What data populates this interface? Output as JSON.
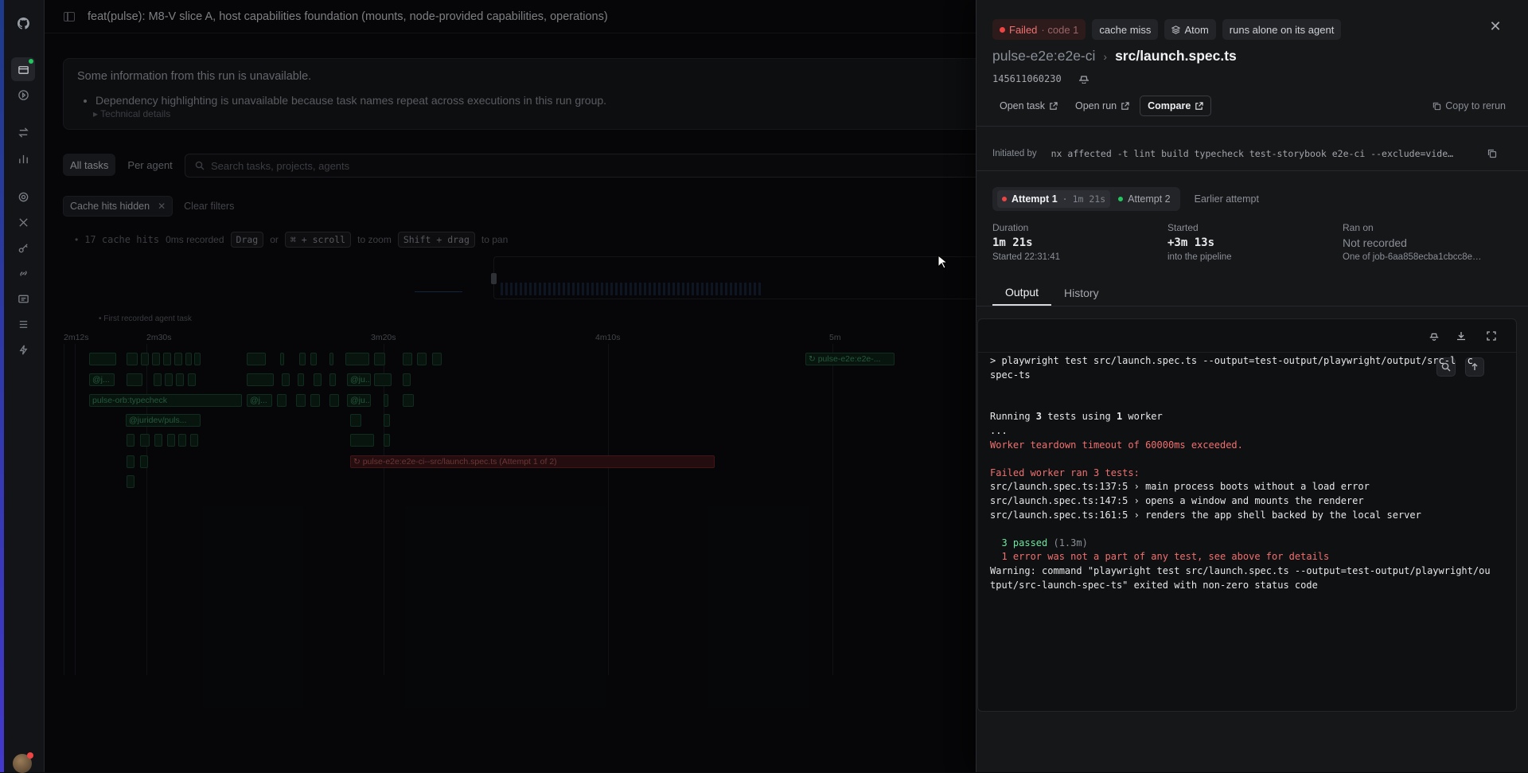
{
  "rail": {
    "icons": [
      "github-icon",
      "box-icon",
      "play-circle-icon",
      "swap-icon",
      "bar-chart-icon",
      "settings-icon",
      "tools-icon",
      "key-icon",
      "link-icon",
      "card-icon",
      "sliders-icon",
      "bolt-icon"
    ]
  },
  "topbar": {
    "title": "feat(pulse): M8-V slice A, host capabilities foundation (mounts, node-provided capabilities, operations)"
  },
  "notice": {
    "heading": "Some information from this run is unavailable.",
    "item": "Dependency highlighting is unavailable because task names repeat across executions in this run group.",
    "details": "▸ Technical details"
  },
  "view_toggle": {
    "all": "All tasks",
    "per_agent": "Per agent"
  },
  "search": {
    "placeholder": "Search tasks, projects, agents"
  },
  "filters": {
    "chip": "Cache hits hidden",
    "clear": "Clear filters"
  },
  "hints": {
    "cache": "17 cache hits",
    "recorded": "0ms recorded",
    "drag": "Drag",
    "or": "or",
    "scroll": "⌘ + scroll",
    "to_zoom": "to zoom",
    "shift_drag": "Shift + drag",
    "to_pan": "to pan"
  },
  "timeline": {
    "first_recorded": "• First recorded agent task",
    "ticks": [
      "2m12s",
      "2m30s",
      "3m20s",
      "4m10s",
      "5m"
    ],
    "labels": {
      "e2e_short": "↻ pulse-e2e:e2e-...",
      "ju1": "@j...",
      "ju2": "@ju...",
      "orb": "pulse-orb:typecheck",
      "j3": "@j...",
      "ju4": "@ju...",
      "juridev": "@juridev/puls...",
      "failed": "↻ pulse-e2e:e2e-ci--src/launch.spec.ts (Attempt 1 of 2)"
    }
  },
  "panel": {
    "badges": {
      "failed": "Failed",
      "code": "· code 1",
      "cache": "cache miss",
      "atom": "Atom",
      "alone": "runs alone on its agent"
    },
    "project": "pulse-e2e:e2e-ci",
    "file": "src/launch.spec.ts",
    "run_id": "145611060230",
    "actions": {
      "open_task": "Open task",
      "open_run": "Open run",
      "compare": "Compare",
      "copy_rerun": "Copy to rerun"
    },
    "initiated_label": "Initiated by",
    "initiated_cmd": "nx affected -t lint build typecheck test-storybook e2e-ci --exclude=vide…",
    "attempts": {
      "a1": "Attempt 1",
      "a1_dur": "1m 21s",
      "a2": "Attempt 2",
      "earlier": "Earlier attempt"
    },
    "stats": {
      "duration_label": "Duration",
      "duration": "1m 21s",
      "duration_sub": "Started 22:31:41",
      "started_label": "Started",
      "started": "+3m 13s",
      "started_sub": "into the pipeline",
      "ran_label": "Ran on",
      "ran": "Not recorded",
      "ran_sub": "One of job-6aa858ecba1cbcc8e…"
    },
    "tabs": {
      "output": "Output",
      "history": "History"
    },
    "colors": {
      "failed": "#ef4444",
      "passed": "#22c55e",
      "error_text": "#f07070"
    }
  },
  "terminal": {
    "l1": "> playwright test src/launch.spec.ts --output=test-output/playwright/output/src-l  c",
    "l2": "spec-ts",
    "l3": "",
    "l4": "",
    "l5a": "Running ",
    "l5b": "3",
    "l5c": " tests using ",
    "l5d": "1",
    "l5e": " worker",
    "l6": "...",
    "l7": "Worker teardown timeout of 60000ms exceeded.",
    "l8": "",
    "l9": "Failed worker ran 3 tests:",
    "l10": "src/launch.spec.ts:137:5 › main process boots without a load error",
    "l11": "src/launch.spec.ts:147:5 › opens a window and mounts the renderer",
    "l12": "src/launch.spec.ts:161:5 › renders the app shell backed by the local server",
    "l13": "",
    "l14a": "  3 passed",
    "l14b": " (1.3m)",
    "l15": "  1 error was not a part of any test, see above for details",
    "l16": "Warning: command \"playwright test src/launch.spec.ts --output=test-output/playwright/ou",
    "l17": "tput/src-launch-spec-ts\" exited with non-zero status code"
  }
}
